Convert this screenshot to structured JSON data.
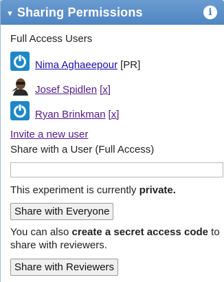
{
  "panel": {
    "title": "Sharing Permissions",
    "caret_icon": "caret-down-icon",
    "info_icon": "info-icon",
    "info_glyph": "i",
    "header_color": "#5b8fc7"
  },
  "full_access": {
    "label": "Full Access Users",
    "users": [
      {
        "name": "Nima Aghaeepour",
        "meta": "[PR]",
        "avatar": "power-logo-icon"
      },
      {
        "name": "Josef Spidlen",
        "remove": "[x]",
        "avatar": "user-photo"
      },
      {
        "name": "Ryan Brinkman",
        "remove": "[x]",
        "avatar": "power-logo-icon"
      }
    ]
  },
  "invite": {
    "label": "Invite a new user"
  },
  "share_user": {
    "label": "Share with a User (Full Access)",
    "input_value": ""
  },
  "privacy": {
    "status_prefix": "This experiment is currently ",
    "status_value": "private."
  },
  "buttons": {
    "share_everyone": "Share with Everyone",
    "share_reviewers": "Share with Reviewers"
  },
  "secret": {
    "prefix": "You can also ",
    "bold": "create a secret access code",
    "suffix": " to share with reviewers."
  }
}
